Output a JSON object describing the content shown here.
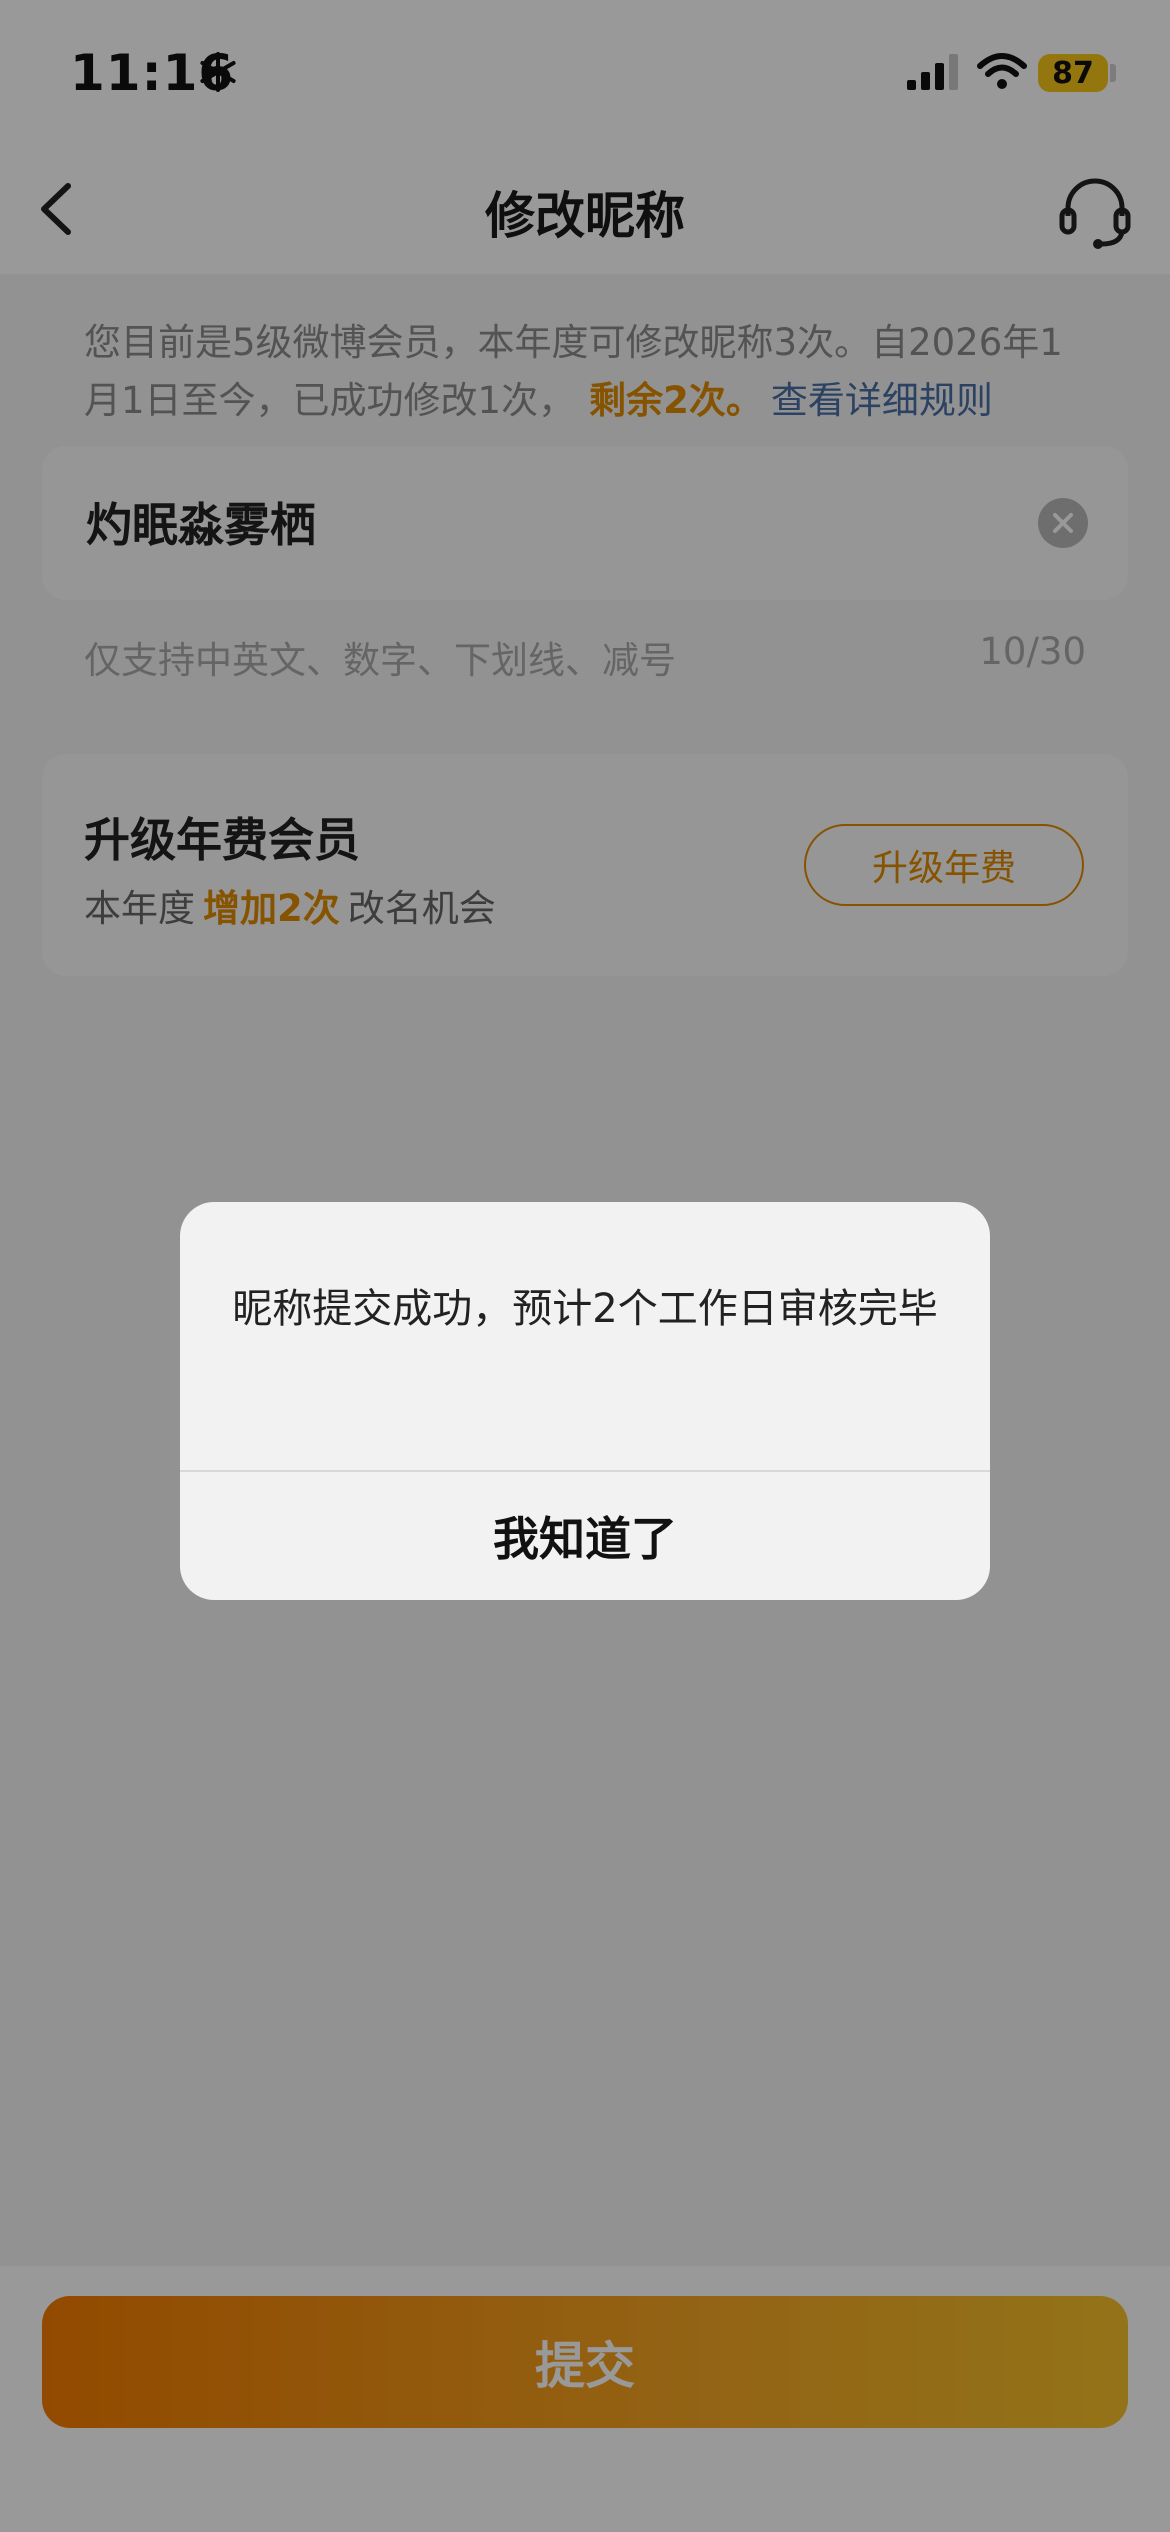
{
  "status_bar": {
    "time": "11:16",
    "battery": "87",
    "battery_color": "#f5c518"
  },
  "nav": {
    "title": "修改昵称",
    "back_icon": "chevron-left-icon",
    "service_icon": "headset-icon"
  },
  "notice": {
    "text": "您目前是5级微博会员，本年度可修改昵称3次。自2026年1月1日至今，已成功修改1次，",
    "remaining": "剩余2次。",
    "rules_link": "查看详细规则"
  },
  "nickname_input": {
    "value": "灼眠淼雾栖",
    "clear_icon": "clear-icon"
  },
  "hint": {
    "text": "仅支持中英文、数字、下划线、减号",
    "counter": "10/30"
  },
  "upgrade": {
    "title": "升级年费会员",
    "sub_prefix": "本年度",
    "sub_highlight": "增加2次",
    "sub_suffix": "改名机会",
    "button": "升级年费"
  },
  "submit": {
    "label": "提交"
  },
  "dialog": {
    "message": "昵称提交成功，预计2个工作日审核完毕",
    "ok": "我知道了"
  },
  "colors": {
    "accent": "#e08a00",
    "link": "#4a6fa5"
  }
}
